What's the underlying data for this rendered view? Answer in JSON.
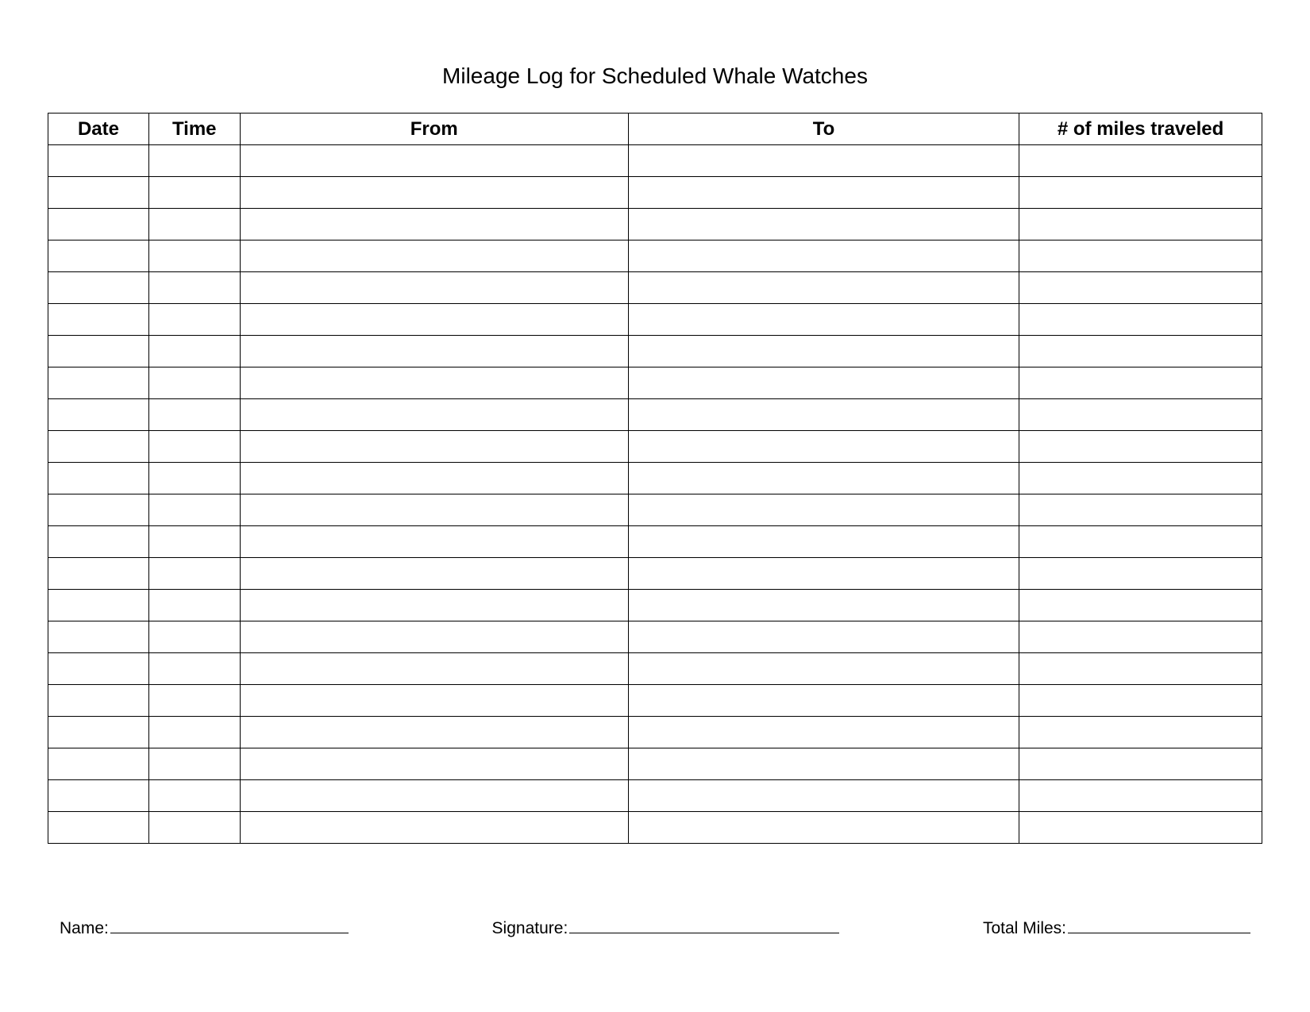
{
  "title": "Mileage Log for Scheduled Whale Watches",
  "headers": {
    "date": "Date",
    "time": "Time",
    "from": "From",
    "to": "To",
    "miles": "# of miles traveled"
  },
  "rows": [
    {
      "date": "",
      "time": "",
      "from": "",
      "to": "",
      "miles": ""
    },
    {
      "date": "",
      "time": "",
      "from": "",
      "to": "",
      "miles": ""
    },
    {
      "date": "",
      "time": "",
      "from": "",
      "to": "",
      "miles": ""
    },
    {
      "date": "",
      "time": "",
      "from": "",
      "to": "",
      "miles": ""
    },
    {
      "date": "",
      "time": "",
      "from": "",
      "to": "",
      "miles": ""
    },
    {
      "date": "",
      "time": "",
      "from": "",
      "to": "",
      "miles": ""
    },
    {
      "date": "",
      "time": "",
      "from": "",
      "to": "",
      "miles": ""
    },
    {
      "date": "",
      "time": "",
      "from": "",
      "to": "",
      "miles": ""
    },
    {
      "date": "",
      "time": "",
      "from": "",
      "to": "",
      "miles": ""
    },
    {
      "date": "",
      "time": "",
      "from": "",
      "to": "",
      "miles": ""
    },
    {
      "date": "",
      "time": "",
      "from": "",
      "to": "",
      "miles": ""
    },
    {
      "date": "",
      "time": "",
      "from": "",
      "to": "",
      "miles": ""
    },
    {
      "date": "",
      "time": "",
      "from": "",
      "to": "",
      "miles": ""
    },
    {
      "date": "",
      "time": "",
      "from": "",
      "to": "",
      "miles": ""
    },
    {
      "date": "",
      "time": "",
      "from": "",
      "to": "",
      "miles": ""
    },
    {
      "date": "",
      "time": "",
      "from": "",
      "to": "",
      "miles": ""
    },
    {
      "date": "",
      "time": "",
      "from": "",
      "to": "",
      "miles": ""
    },
    {
      "date": "",
      "time": "",
      "from": "",
      "to": "",
      "miles": ""
    },
    {
      "date": "",
      "time": "",
      "from": "",
      "to": "",
      "miles": ""
    },
    {
      "date": "",
      "time": "",
      "from": "",
      "to": "",
      "miles": ""
    },
    {
      "date": "",
      "time": "",
      "from": "",
      "to": "",
      "miles": ""
    },
    {
      "date": "",
      "time": "",
      "from": "",
      "to": "",
      "miles": ""
    }
  ],
  "footer": {
    "name_label": "Name:",
    "signature_label": "Signature:",
    "total_label": "Total Miles:"
  }
}
